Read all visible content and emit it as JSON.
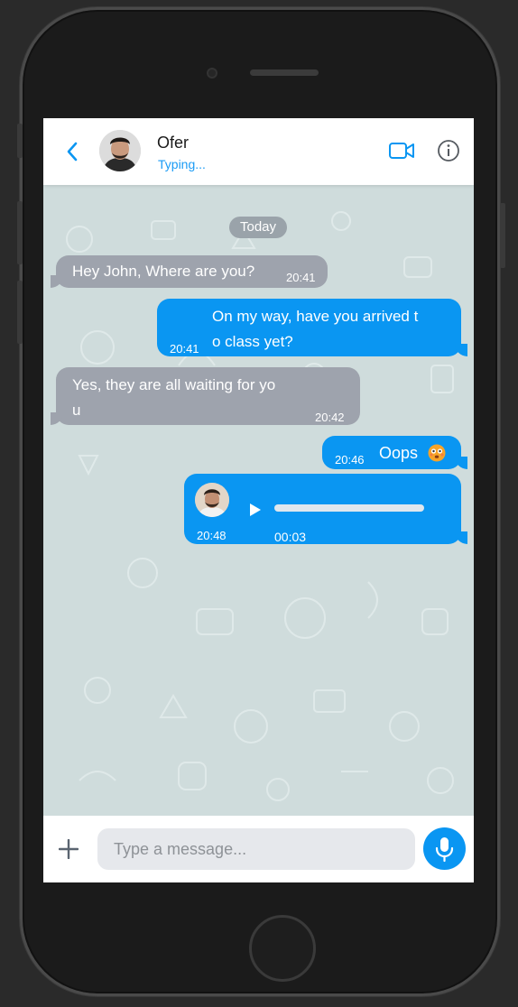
{
  "header": {
    "name": "Ofer",
    "status": "Typing..."
  },
  "chat": {
    "date": "Today",
    "messages": [
      {
        "dir": "in",
        "text": "Hey John, Where are you?",
        "time": "20:41"
      },
      {
        "dir": "out",
        "text": "On my way, have you arrived t\no class yet?",
        "time": "20:41"
      },
      {
        "dir": "in",
        "text": "Yes, they are all waiting for yo\nu",
        "time": "20:42"
      },
      {
        "dir": "out",
        "text": "Oops",
        "emoji": "😳",
        "time": "20:46"
      },
      {
        "dir": "out",
        "type": "voice",
        "duration": "00:03",
        "time": "20:48"
      }
    ]
  },
  "composer": {
    "placeholder": "Type a message..."
  },
  "colors": {
    "accent": "#0a96f2",
    "incoming": "#9ea3ad",
    "background": "#cfdcdc"
  },
  "icons": [
    "back-chevron-icon",
    "video-call-icon",
    "info-icon",
    "play-icon",
    "plus-icon",
    "microphone-icon"
  ]
}
